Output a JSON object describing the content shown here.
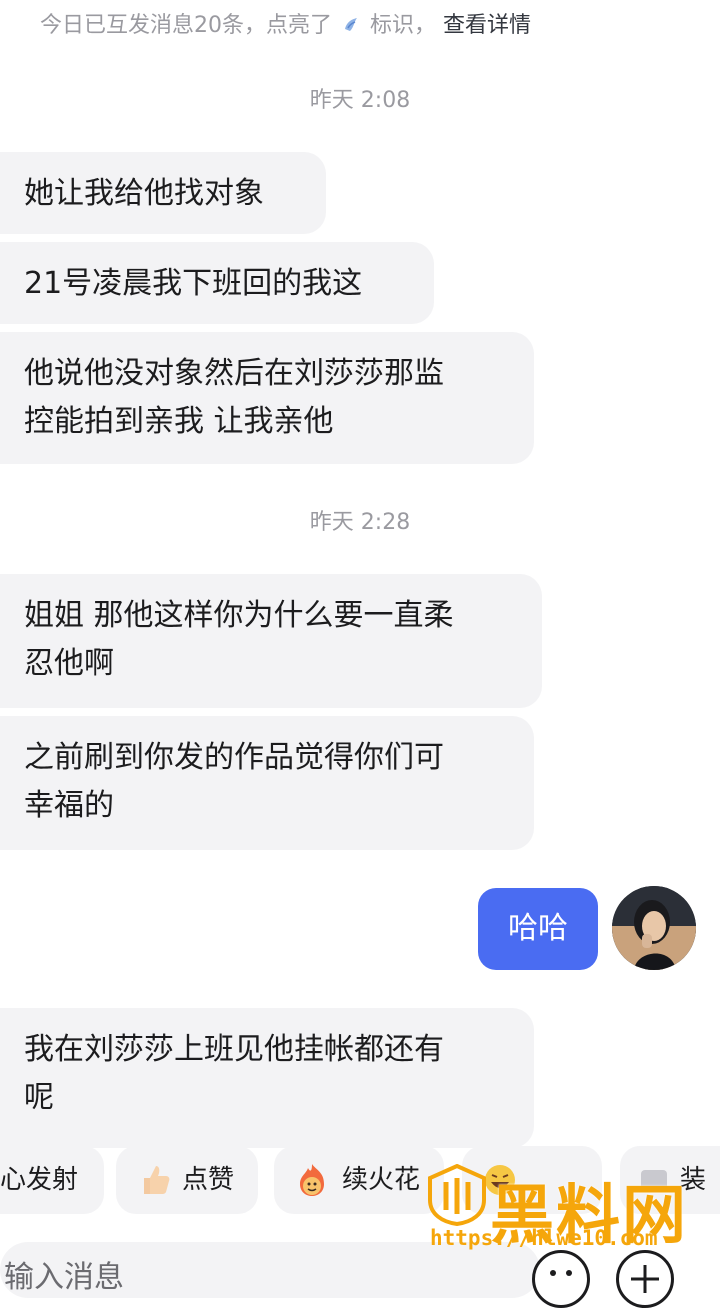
{
  "top_notice": {
    "text_before": "今日已互发消息20条，点亮了",
    "text_after": "标识，",
    "link": "查看详情"
  },
  "messages": [
    {
      "type": "time",
      "text": "昨天 2:08"
    },
    {
      "type": "incoming",
      "lines": [
        "她让我给他找对象"
      ]
    },
    {
      "type": "incoming",
      "lines": [
        "21号凌晨我下班回的我这"
      ]
    },
    {
      "type": "incoming",
      "lines": [
        "他说他没对象然后在刘莎莎那监",
        "控能拍到亲我 让我亲他"
      ]
    },
    {
      "type": "time",
      "text": "昨天 2:28"
    },
    {
      "type": "incoming",
      "lines": [
        "姐姐 那他这样你为什么要一直柔",
        "忍他啊"
      ]
    },
    {
      "type": "incoming",
      "lines": [
        "之前刷到你发的作品觉得你们可",
        "幸福的"
      ]
    },
    {
      "type": "outgoing",
      "lines": [
        "哈哈"
      ]
    },
    {
      "type": "incoming",
      "lines": [
        "我在刘莎莎上班见他挂帐都还有",
        "呢"
      ]
    }
  ],
  "quick_actions": [
    {
      "label": "心发射",
      "icon": "heart-launch-icon"
    },
    {
      "label": "点赞",
      "icon": "thumbs-up-icon"
    },
    {
      "label": "续火花",
      "icon": "fire-face-icon"
    },
    {
      "label": "",
      "icon": "laugh-face-icon"
    },
    {
      "label": "装",
      "icon": "sticker-icon"
    }
  ],
  "input": {
    "placeholder": "输入消息"
  },
  "watermark": {
    "title": "黑料网",
    "url": "https://hlwe10.com"
  },
  "colors": {
    "accent": "#4a6cf2",
    "incoming_bubble": "#f3f3f5",
    "watermark": "#f5a60b"
  }
}
